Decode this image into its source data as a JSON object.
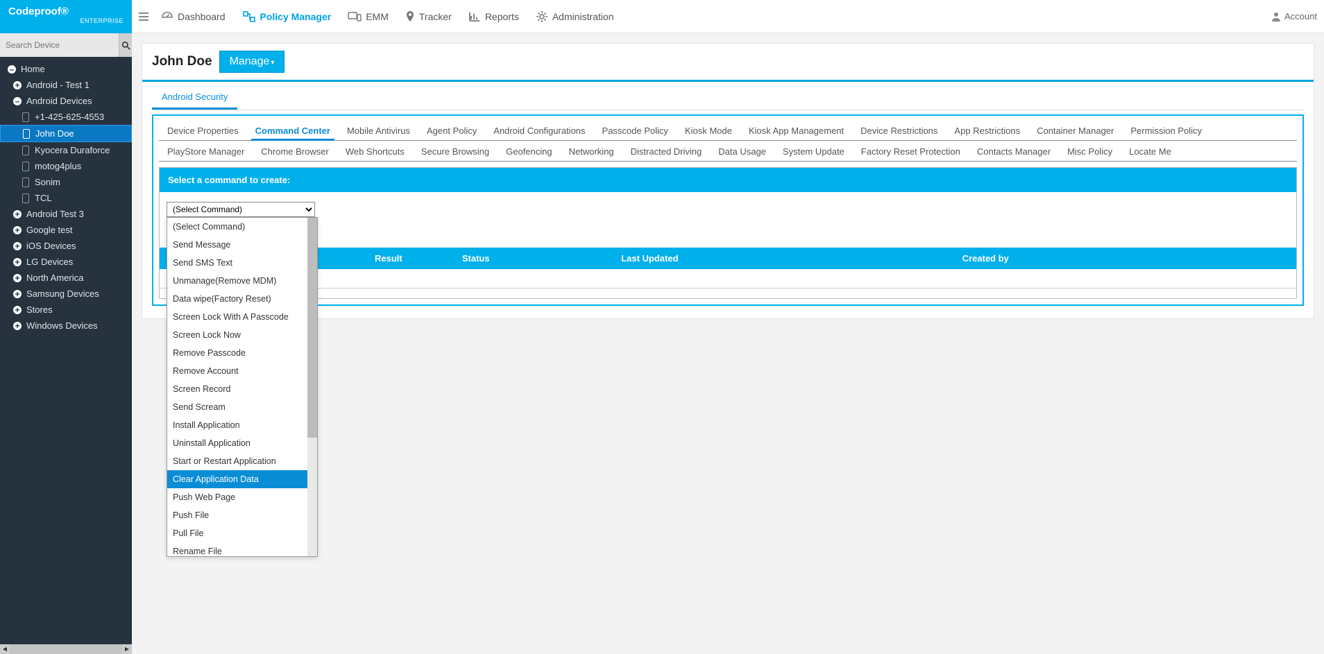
{
  "brand": {
    "title": "Codeproof®",
    "subtitle": "ENTERPRISE"
  },
  "search": {
    "placeholder": "Search Device"
  },
  "tree": {
    "home": "Home",
    "items": [
      {
        "label": "Android - Test 1"
      },
      {
        "label": "Android Devices"
      },
      {
        "label": "+1-425-625-4553"
      },
      {
        "label": "John Doe"
      },
      {
        "label": "Kyocera Duraforce"
      },
      {
        "label": "motog4plus"
      },
      {
        "label": "Sonim"
      },
      {
        "label": "TCL"
      },
      {
        "label": "Android Test 3"
      },
      {
        "label": "Google test"
      },
      {
        "label": "iOS Devices"
      },
      {
        "label": "LG Devices"
      },
      {
        "label": "North America"
      },
      {
        "label": "Samsung Devices"
      },
      {
        "label": "Stores"
      },
      {
        "label": "Windows Devices"
      }
    ]
  },
  "nav": {
    "dashboard": "Dashboard",
    "policy": "Policy Manager",
    "emm": "EMM",
    "tracker": "Tracker",
    "reports": "Reports",
    "admin": "Administration",
    "account": "Account"
  },
  "page": {
    "title": "John Doe",
    "manage": "Manage",
    "primary_tab": "Android Security"
  },
  "subtabs_row1": [
    "Device Properties",
    "Command Center",
    "Mobile Antivirus",
    "Agent Policy",
    "Android Configurations",
    "Passcode Policy",
    "Kiosk Mode",
    "Kiosk App Management",
    "Device Restrictions",
    "App Restrictions",
    "Container Manager",
    "Permission Policy"
  ],
  "subtabs_row2": [
    "PlayStore Manager",
    "Chrome Browser",
    "Web Shortcuts",
    "Secure Browsing",
    "Geofencing",
    "Networking",
    "Distracted Driving",
    "Data Usage",
    "System Update",
    "Factory Reset Protection",
    "Contacts Manager",
    "Misc Policy",
    "Locate Me"
  ],
  "command": {
    "header": "Select a command to create:",
    "selected": "(Select Command)",
    "options": [
      "(Select Command)",
      "Send Message",
      "Send SMS Text",
      "Unmanage(Remove MDM)",
      "Data wipe(Factory Reset)",
      "Screen Lock With A Passcode",
      "Screen Lock Now",
      "Remove Passcode",
      "Remove Account",
      "Screen Record",
      "Send Scream",
      "Install Application",
      "Uninstall Application",
      "Start or Restart Application",
      "Clear Application Data",
      "Push Web Page",
      "Push File",
      "Pull File",
      "Rename File"
    ],
    "highlight_index": 14
  },
  "table": {
    "cols": {
      "result": "Result",
      "status": "Status",
      "updated": "Last Updated",
      "created": "Created by"
    }
  }
}
